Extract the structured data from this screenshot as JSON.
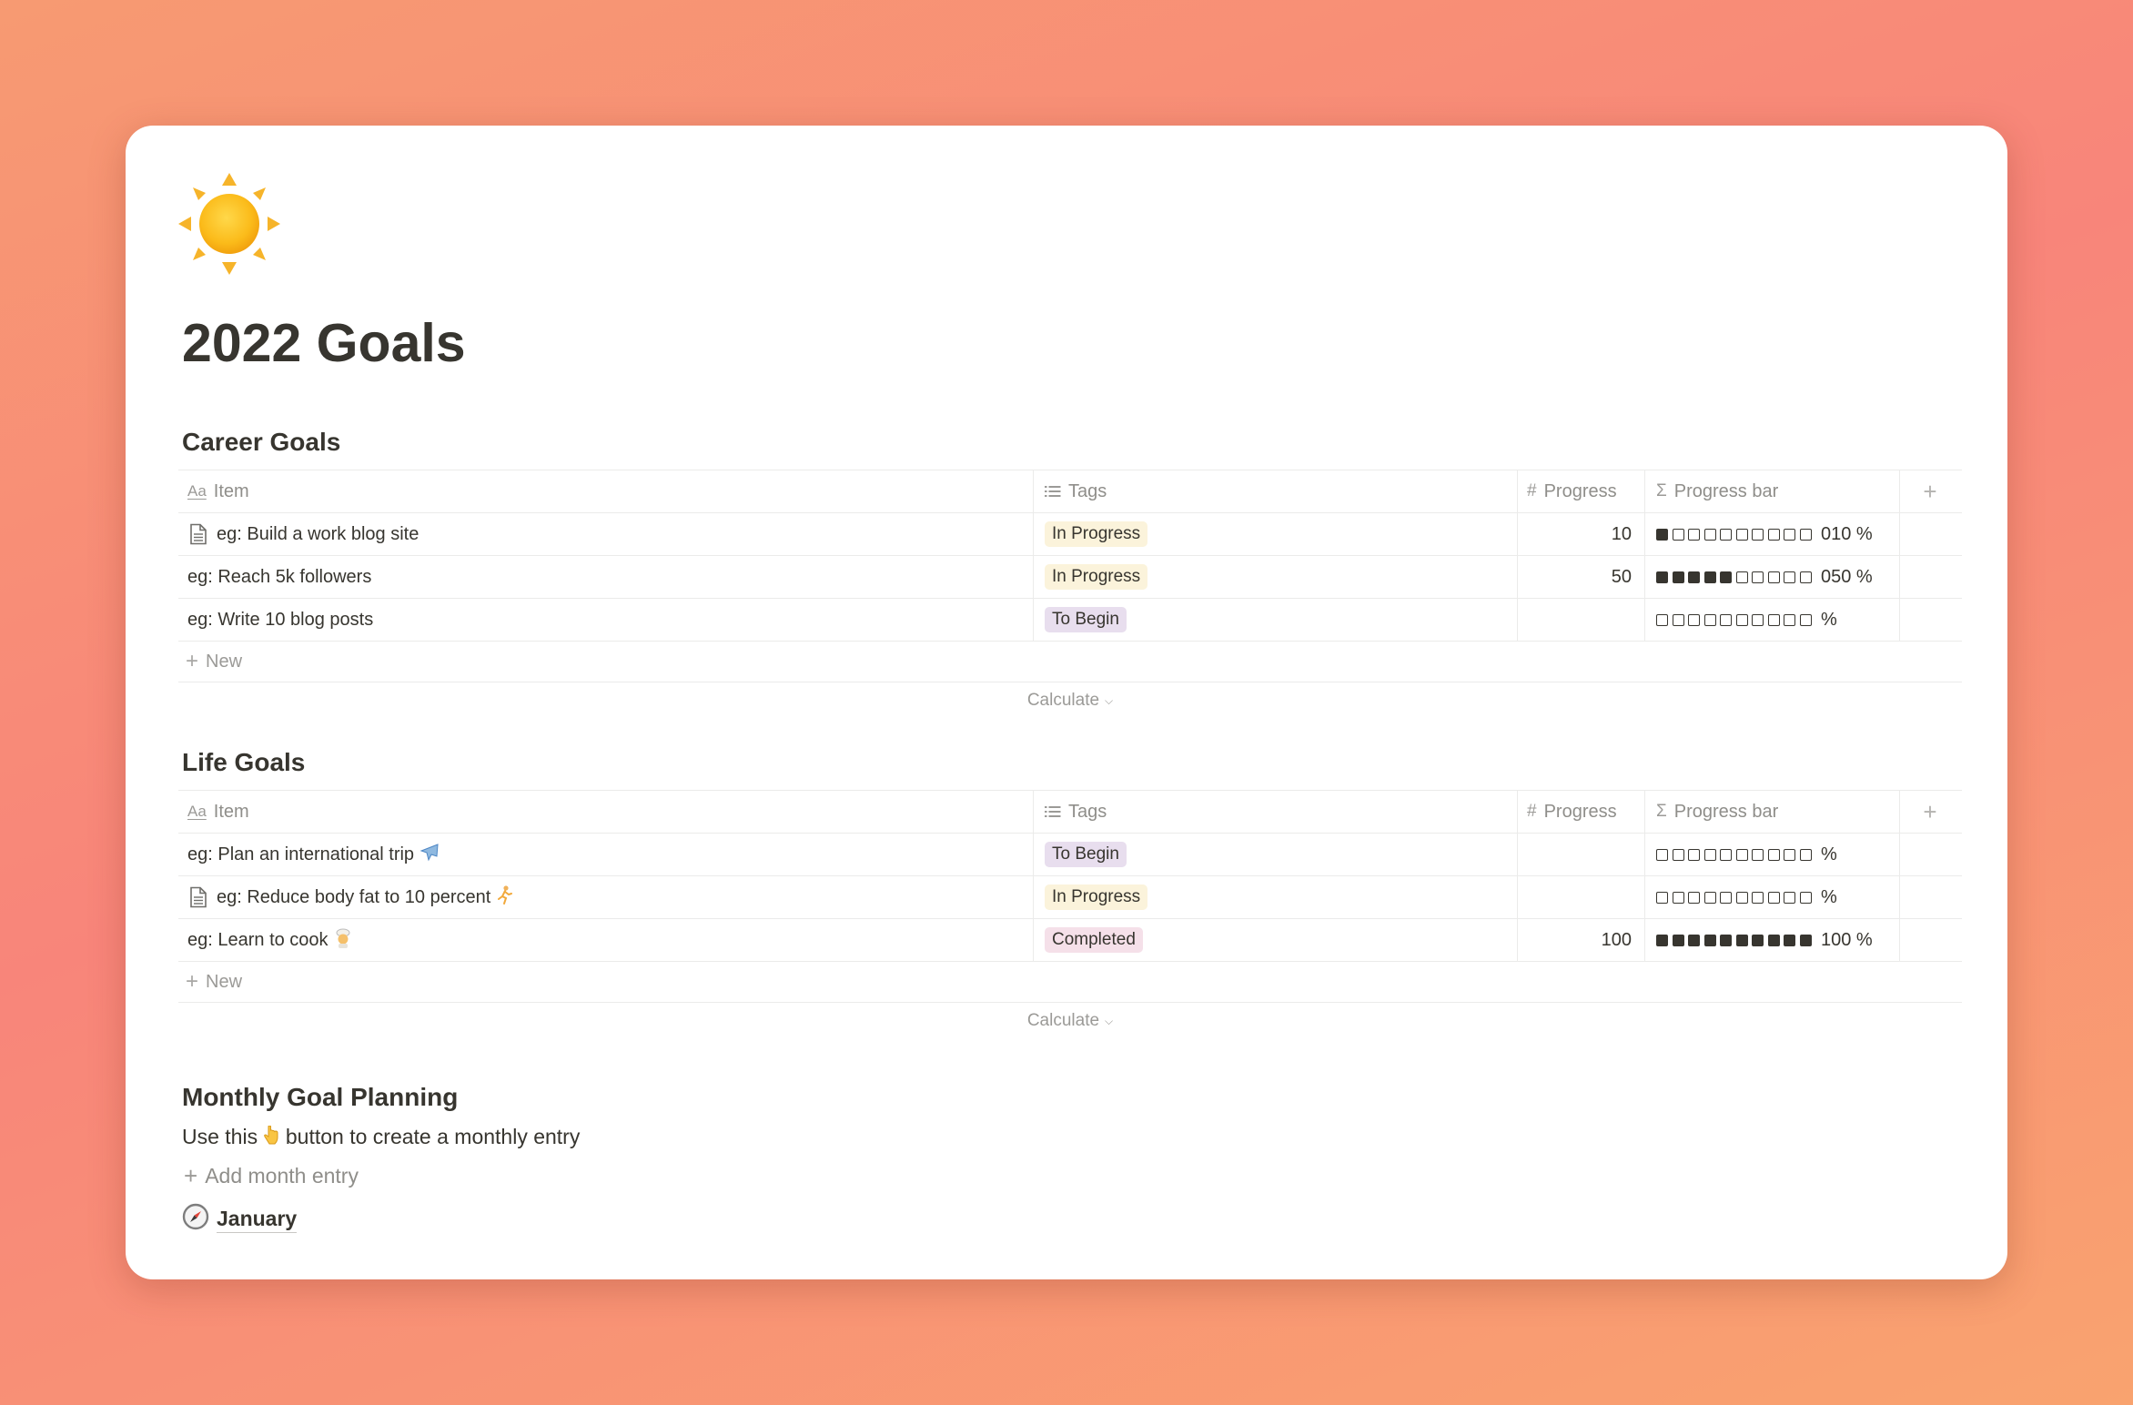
{
  "page": {
    "icon": "sun-icon",
    "title": "2022 Goals"
  },
  "columns": {
    "item": "Item",
    "tags": "Tags",
    "progress": "Progress",
    "progress_bar": "Progress bar"
  },
  "career": {
    "title": "Career Goals",
    "rows": [
      {
        "item": "eg: Build a work blog site",
        "has_doc_icon": true,
        "tag": "In Progress",
        "progress": "10",
        "filled": 1,
        "pct": "010 %"
      },
      {
        "item": "eg: Reach 5k followers",
        "has_doc_icon": false,
        "tag": "In Progress",
        "progress": "50",
        "filled": 5,
        "pct": "050 %"
      },
      {
        "item": "eg: Write 10 blog posts",
        "has_doc_icon": false,
        "tag": "To Begin",
        "progress": "",
        "filled": 0,
        "pct": " %"
      }
    ],
    "new_label": "New",
    "calculate_label": "Calculate"
  },
  "life": {
    "title": "Life Goals",
    "rows": [
      {
        "item": "eg: Plan an international trip",
        "emoji": "airplane-icon",
        "has_doc_icon": false,
        "tag": "To Begin",
        "progress": "",
        "filled": 0,
        "pct": " %"
      },
      {
        "item": "eg: Reduce body fat to 10 percent",
        "emoji": "runner-icon",
        "has_doc_icon": true,
        "tag": "In Progress",
        "progress": "",
        "filled": 0,
        "pct": " %"
      },
      {
        "item": "eg: Learn to cook",
        "emoji": "cook-icon",
        "has_doc_icon": false,
        "tag": "Completed",
        "progress": "100",
        "filled": 10,
        "pct": "100 %"
      }
    ],
    "new_label": "New",
    "calculate_label": "Calculate"
  },
  "monthly": {
    "title": "Monthly Goal Planning",
    "text_before": "Use this",
    "text_after": "button to create a monthly entry",
    "pointer_icon": "pointing-down-icon",
    "add_label": "Add month entry",
    "entry_icon": "compass-icon",
    "entry_label": "January"
  },
  "colors": {
    "in_progress": "#fbf3db",
    "to_begin": "#e8deee",
    "completed": "#f5e0e9",
    "text": "#37352f"
  }
}
